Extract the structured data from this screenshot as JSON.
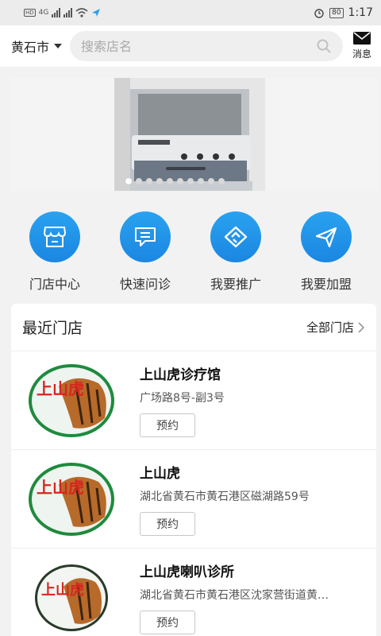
{
  "status_bar": {
    "time": "1:17",
    "battery": "80",
    "hd": "HD",
    "network": "4G"
  },
  "header": {
    "city": "黄石市",
    "search_placeholder": "搜索店名",
    "message_label": "消息"
  },
  "banner": {
    "dot_count": 10,
    "active_dot": 0
  },
  "shortcuts": [
    {
      "label": "门店中心",
      "icon": "store-icon"
    },
    {
      "label": "快速问诊",
      "icon": "chat-icon"
    },
    {
      "label": "我要推广",
      "icon": "handshake-icon"
    },
    {
      "label": "我要加盟",
      "icon": "paper-plane-icon"
    }
  ],
  "recent": {
    "title": "最近门店",
    "more_label": "全部门店",
    "stores": [
      {
        "name": "上山虎诊疗馆",
        "address": "广场路8号-副3号",
        "button": "预约",
        "logo_text": "上山虎"
      },
      {
        "name": "上山虎",
        "address": "湖北省黄石市黄石港区磁湖路59号",
        "button": "预约",
        "logo_text": "上山虎"
      },
      {
        "name": "上山虎喇叭诊所",
        "address": "湖北省黄石市黄石港区沈家营街道黄…",
        "button": "预约",
        "logo_text": "上山虎"
      }
    ]
  },
  "colors": {
    "accent": "#1e90e8",
    "logo_red": "#d7261e"
  }
}
